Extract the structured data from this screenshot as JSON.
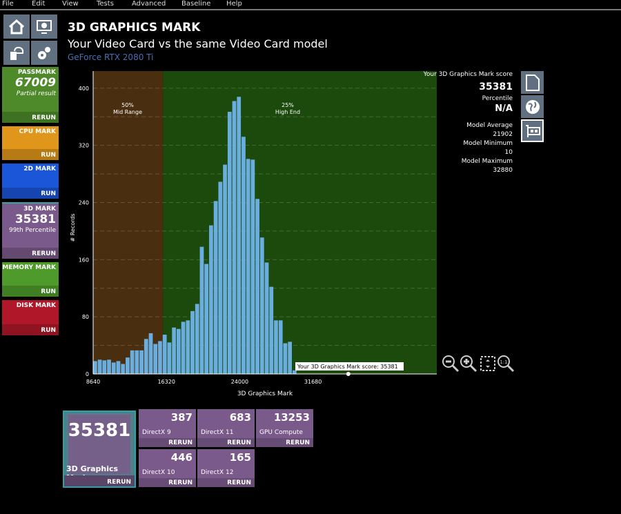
{
  "menu": [
    "File",
    "Edit",
    "View",
    "Tests",
    "Advanced",
    "Baseline",
    "Help"
  ],
  "header": {
    "title": "3D GRAPHICS MARK",
    "subtitle": "Your Video Card vs the same Video Card model",
    "model": "GeForce RTX 2080 Ti"
  },
  "sidebar": [
    {
      "label": "PASSMARK",
      "score": "67009",
      "sub": "Partial result",
      "action": "RERUN",
      "color": "#4e8a2a"
    },
    {
      "label": "CPU MARK",
      "action": "RUN",
      "color": "#e0961a"
    },
    {
      "label": "2D MARK",
      "action": "RUN",
      "color": "#1b55d8"
    },
    {
      "label": "3D MARK",
      "score": "35381",
      "sub": "99th Percentile",
      "action": "RERUN",
      "color": "#7a5a8a"
    },
    {
      "label": "MEMORY MARK",
      "action": "RUN",
      "color": "#4e9a2a"
    },
    {
      "label": "DISK MARK",
      "action": "RUN",
      "color": "#b0182a"
    }
  ],
  "stats": {
    "score_label": "Your 3D Graphics Mark score",
    "score": "35381",
    "percentile_label": "Percentile",
    "percentile": "N/A",
    "avg_label": "Model Average",
    "avg": "21902",
    "min_label": "Model Minimum",
    "min": "10",
    "max_label": "Model Maximum",
    "max": "32880"
  },
  "chart_data": {
    "type": "bar",
    "xlabel": "3D Graphics Mark",
    "ylabel": "# Records",
    "xticks": [
      8640,
      16320,
      24000,
      31680
    ],
    "yticks": [
      0,
      80,
      160,
      240,
      320,
      400
    ],
    "ylim": [
      0,
      424
    ],
    "xlim": [
      8640,
      44650
    ],
    "bin_start": 8640,
    "bin_width": 486,
    "values": [
      18,
      20,
      19,
      20,
      16,
      18,
      14,
      23,
      33,
      33,
      33,
      49,
      57,
      42,
      46,
      55,
      44,
      65,
      63,
      73,
      75,
      88,
      98,
      178,
      154,
      208,
      242,
      269,
      293,
      367,
      382,
      388,
      332,
      301,
      300,
      245,
      191,
      156,
      122,
      75,
      75,
      43,
      45,
      5
    ],
    "regions": [
      {
        "pct": "50%",
        "name": "Mid Range",
        "from": 8640,
        "to": 15960,
        "color": "#4a2e10"
      },
      {
        "pct": "25%",
        "name": "High End",
        "from": 15960,
        "to": 44650,
        "color": "#1c4a0c"
      }
    ],
    "marker": {
      "value": 35381,
      "label": "Your 3D Graphics Mark score: 35381"
    },
    "grid": true,
    "bar_color": "#6aaee0"
  },
  "bottom": {
    "main": {
      "score": "35381",
      "label": "3D Graphics Mark",
      "action": "RERUN"
    },
    "tests": [
      {
        "value": "387",
        "name": "DirectX 9",
        "action": "RERUN"
      },
      {
        "value": "683",
        "name": "DirectX 11",
        "action": "RERUN"
      },
      {
        "value": "13253",
        "name": "GPU Compute",
        "action": "RERUN"
      },
      {
        "value": "446",
        "name": "DirectX 10",
        "action": "RERUN"
      },
      {
        "value": "165",
        "name": "DirectX 12",
        "action": "RERUN"
      }
    ]
  }
}
